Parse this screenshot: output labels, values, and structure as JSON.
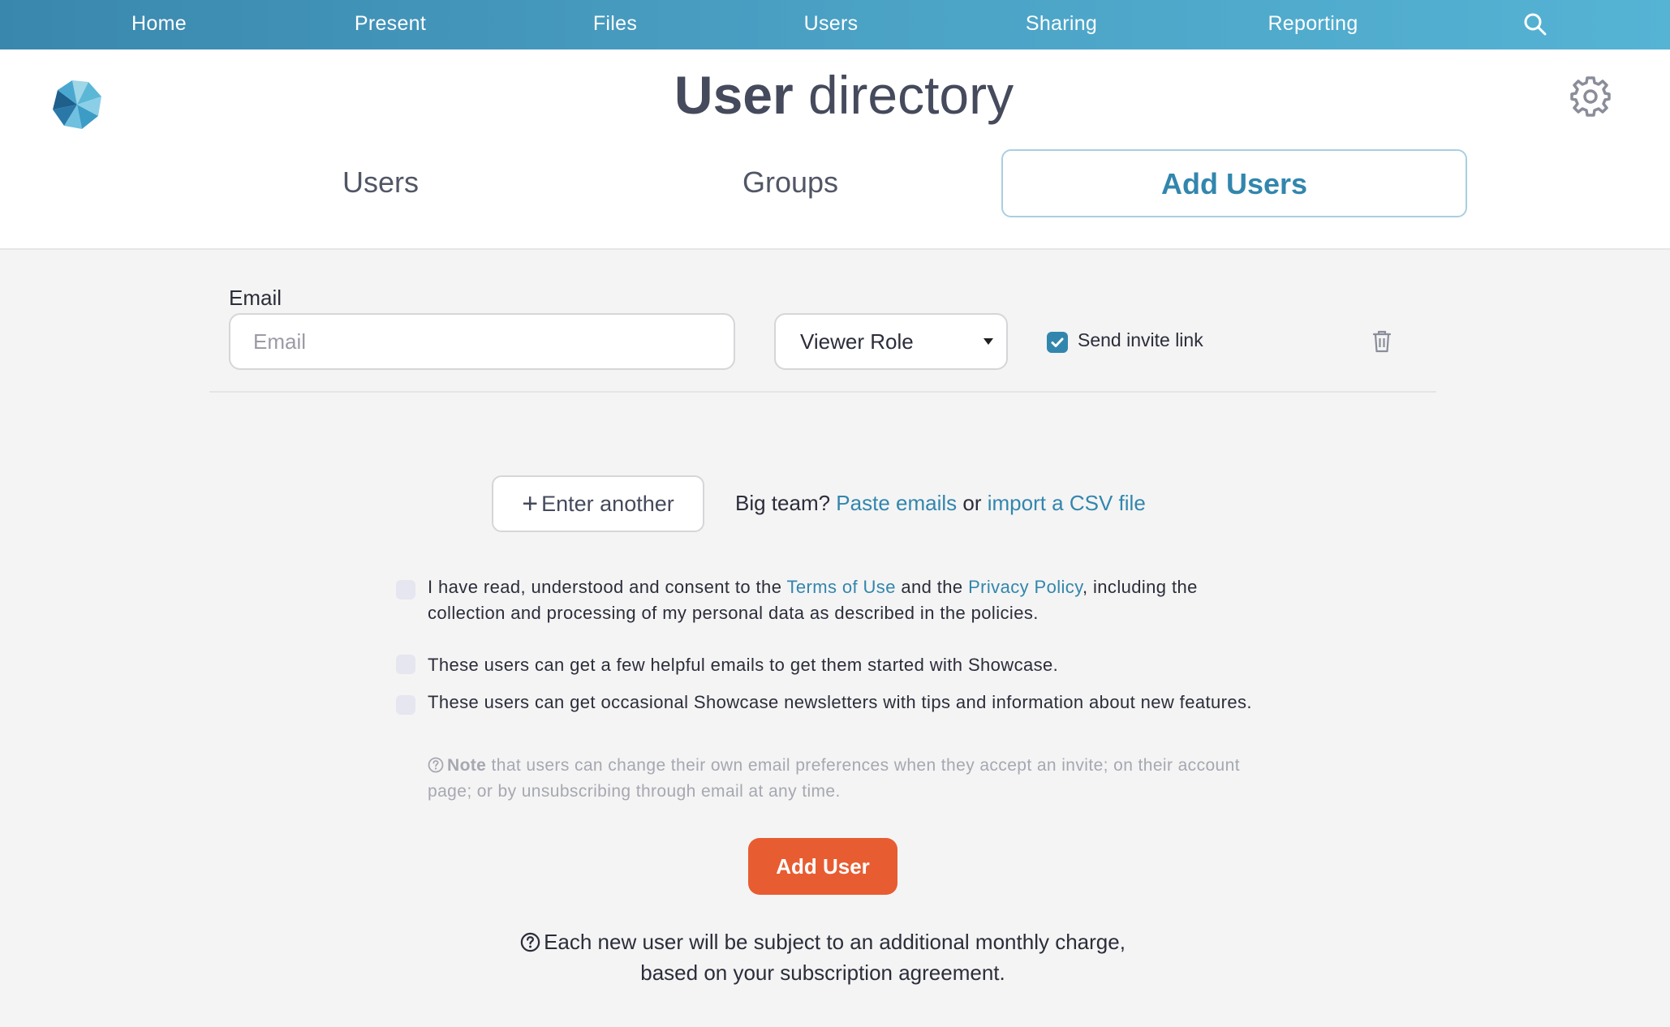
{
  "nav": {
    "items": [
      {
        "label": "Home"
      },
      {
        "label": "Present"
      },
      {
        "label": "Files"
      },
      {
        "label": "Users"
      },
      {
        "label": "Sharing"
      },
      {
        "label": "Reporting"
      }
    ],
    "search_icon": "search-icon"
  },
  "header": {
    "title_bold": "User",
    "title_rest": " directory",
    "settings_icon": "gear-icon",
    "logo_icon": "showcase-logo-icon"
  },
  "tabs": [
    {
      "label": "Users",
      "active": false
    },
    {
      "label": "Groups",
      "active": false
    },
    {
      "label": "Add Users",
      "active": true
    }
  ],
  "form": {
    "email_label": "Email",
    "email_placeholder": "Email",
    "email_value": "",
    "role_value": "Viewer Role",
    "invite_label": "Send invite link",
    "invite_checked": true,
    "trash_icon": "trash-icon"
  },
  "enter_another": {
    "label": "Enter another",
    "prefix": "Big team? ",
    "paste_link": "Paste emails",
    "or": " or ",
    "csv_link": "import a CSV file"
  },
  "consent": {
    "terms_pre": "I have read, understood and consent to the ",
    "terms_link": "Terms of Use",
    "terms_mid": " and the ",
    "privacy_link": "Privacy Policy",
    "terms_post": ", including the collection and processing of my personal data as described in the policies.",
    "helpful_emails": "These users can get a few helpful emails to get them started with Showcase.",
    "newsletters": "These users can get occasional Showcase newsletters with tips and information about new features.",
    "note_bold": "Note",
    "note_text": " that users can change their own email preferences when they accept an invite; on their account page; or by unsubscribing through email at any time."
  },
  "submit": {
    "label": "Add User"
  },
  "charge_note": "Each new user will be subject to an additional monthly charge, based on your subscription agreement.",
  "colors": {
    "nav_start": "#3a87ad",
    "nav_end": "#55b3d4",
    "accent": "#3286ad",
    "primary_button": "#e85c32",
    "background": "#f4f4f4"
  }
}
